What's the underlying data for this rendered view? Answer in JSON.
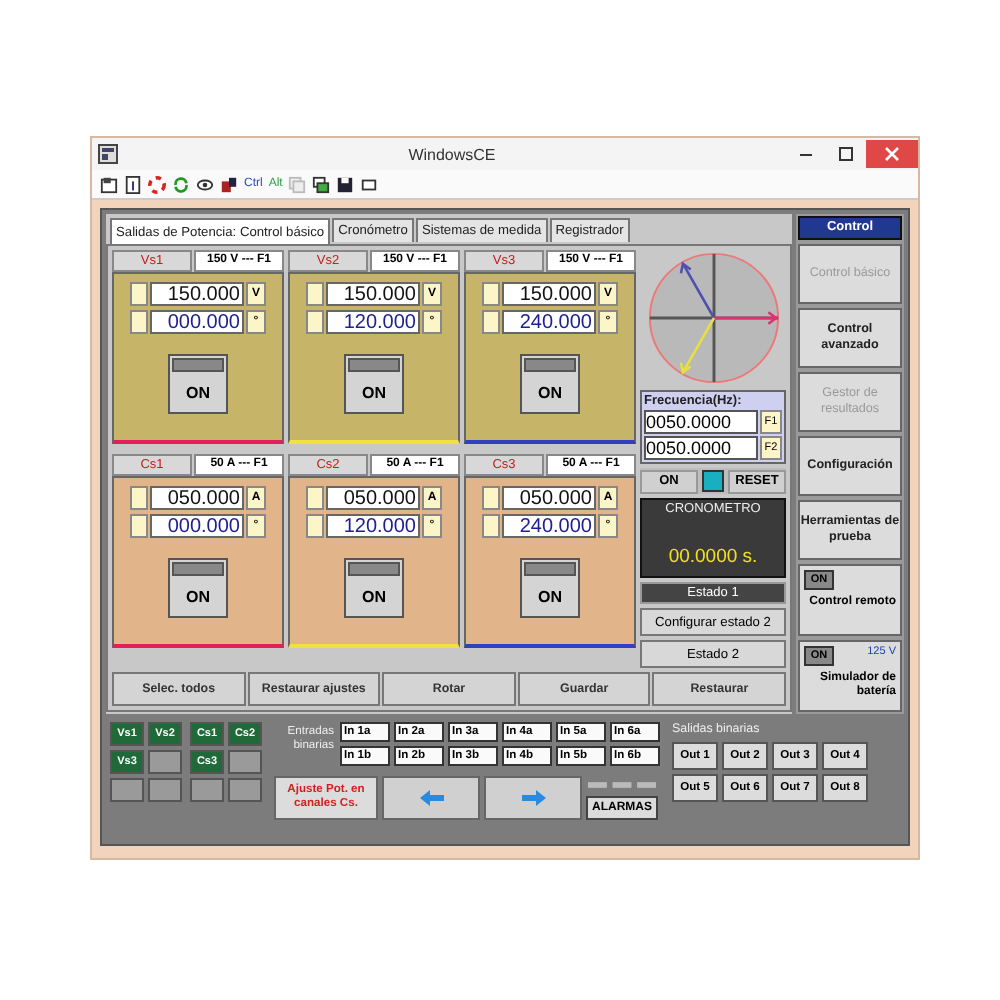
{
  "window": {
    "title": "WindowsCE"
  },
  "toolbar": {
    "ctrl_label": "Ctrl",
    "alt_label": "Alt"
  },
  "tabs": [
    {
      "label": "Salidas de Potencia: Control básico",
      "selected": true
    },
    {
      "label": "Cronómetro",
      "selected": false
    },
    {
      "label": "Sistemas de medida",
      "selected": false
    },
    {
      "label": "Registrador",
      "selected": false
    }
  ],
  "voltage_channels": [
    {
      "label": "Vs1",
      "range": "150 V --- F1",
      "amplitude": "150.000",
      "amplitude_unit": "V",
      "phase": "000.000",
      "phase_unit": "°",
      "button": "ON",
      "color": "#e0205a"
    },
    {
      "label": "Vs2",
      "range": "150 V --- F1",
      "amplitude": "150.000",
      "amplitude_unit": "V",
      "phase": "120.000",
      "phase_unit": "°",
      "button": "ON",
      "color": "#f0e040"
    },
    {
      "label": "Vs3",
      "range": "150 V --- F1",
      "amplitude": "150.000",
      "amplitude_unit": "V",
      "phase": "240.000",
      "phase_unit": "°",
      "button": "ON",
      "color": "#3040c0"
    }
  ],
  "current_channels": [
    {
      "label": "Cs1",
      "range": "50 A --- F1",
      "amplitude": "050.000",
      "amplitude_unit": "A",
      "phase": "000.000",
      "phase_unit": "°",
      "button": "ON",
      "color": "#e0205a"
    },
    {
      "label": "Cs2",
      "range": "50 A --- F1",
      "amplitude": "050.000",
      "amplitude_unit": "A",
      "phase": "120.000",
      "phase_unit": "°",
      "button": "ON",
      "color": "#f0e040"
    },
    {
      "label": "Cs3",
      "range": "50 A --- F1",
      "amplitude": "050.000",
      "amplitude_unit": "A",
      "phase": "240.000",
      "phase_unit": "°",
      "button": "ON",
      "color": "#3040c0"
    }
  ],
  "frequency": {
    "label": "Frecuencia(Hz):",
    "values": [
      {
        "value": "0050.0000",
        "tag": "F1"
      },
      {
        "value": "0050.0000",
        "tag": "F2"
      }
    ]
  },
  "timer": {
    "on_label": "ON",
    "reset_label": "RESET",
    "title": "CRONOMETRO",
    "reading": "00.0000 s."
  },
  "states": {
    "current": "Estado 1",
    "configure": "Configurar estado 2",
    "next": "Estado 2"
  },
  "actions": [
    "Selec. todos",
    "Restaurar ajustes",
    "Rotar",
    "Guardar",
    "Restaurar"
  ],
  "sidebar": {
    "title": "Control",
    "items": [
      {
        "kind": "nav",
        "label": "Control básico",
        "disabled": true
      },
      {
        "kind": "nav",
        "label": "Control avanzado",
        "disabled": false
      },
      {
        "kind": "nav",
        "label": "Gestor de resultados",
        "disabled": true
      },
      {
        "kind": "nav",
        "label": "Configuración",
        "disabled": false
      },
      {
        "kind": "nav",
        "label": "Herramientas de prueba",
        "disabled": false
      },
      {
        "kind": "toggle",
        "switch": "ON",
        "label": "Control remoto"
      },
      {
        "kind": "toggle",
        "switch": "ON",
        "label": "Simulador de batería",
        "reading": "125 V"
      }
    ]
  },
  "indicators": [
    [
      {
        "label": "Vs1",
        "active": true
      },
      {
        "label": "Vs2",
        "active": true
      },
      {
        "label": "Vs3",
        "active": true
      },
      {
        "active": false
      },
      {
        "active": false
      },
      {
        "active": false
      }
    ],
    [
      {
        "label": "Cs1",
        "active": true
      },
      {
        "label": "Cs2",
        "active": true
      },
      {
        "label": "Cs3",
        "active": true
      },
      {
        "active": false
      },
      {
        "active": false
      },
      {
        "active": false
      }
    ]
  ],
  "binary_inputs": {
    "label": "Entradas binarias",
    "items": [
      "In 1a",
      "In 2a",
      "In 3a",
      "In 4a",
      "In 5a",
      "In 6a",
      "In 1b",
      "In 2b",
      "In 3b",
      "In 4b",
      "In 5b",
      "In 6b"
    ]
  },
  "power_adjust_button": "Ajuste Pot. en canales Cs.",
  "alarms_button": "ALARMAS",
  "binary_outputs": {
    "label": "Salidas binarias",
    "items": [
      "Out 1",
      "Out 2",
      "Out 3",
      "Out 4",
      "Out 5",
      "Out 6",
      "Out 7",
      "Out 8"
    ]
  }
}
